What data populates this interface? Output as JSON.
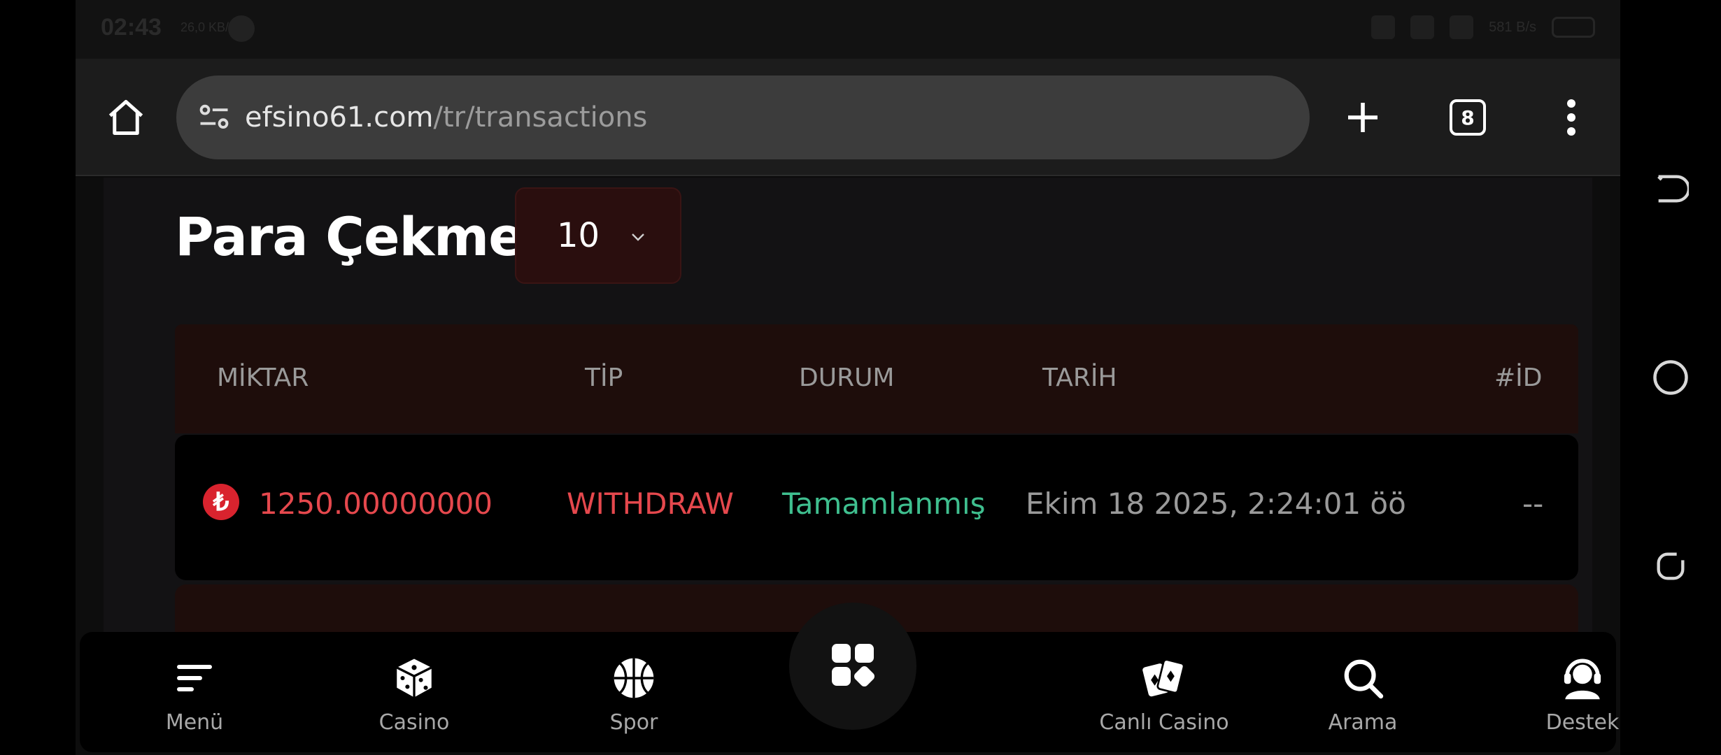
{
  "status_bar": {
    "time": "02:43",
    "net_speed": "26,0 KB/S",
    "speed": "581 B/s"
  },
  "browser": {
    "url_domain": "efsino61.com",
    "url_path": "/tr/transactions",
    "tabs_count": "8"
  },
  "page": {
    "title": "Para Çekme",
    "page_size": "10",
    "columns": [
      "MİKTAR",
      "TİP",
      "DURUM",
      "TARİH",
      "#İD"
    ],
    "rows": [
      {
        "currency_symbol": "₺",
        "amount": "1250.00000000",
        "type": "WITHDRAW",
        "status": "Tamamlanmış",
        "date": "Ekim 18 2025, 2:24:01 öö",
        "id": "--"
      }
    ]
  },
  "bottom_nav": {
    "items": [
      "Menü",
      "Casino",
      "Spor",
      "Canlı Casino",
      "Arama",
      "Destek"
    ]
  },
  "colors": {
    "accent_red": "#e5484d",
    "status_green": "#3fbf8f",
    "header_bg": "#1e0d0b"
  }
}
